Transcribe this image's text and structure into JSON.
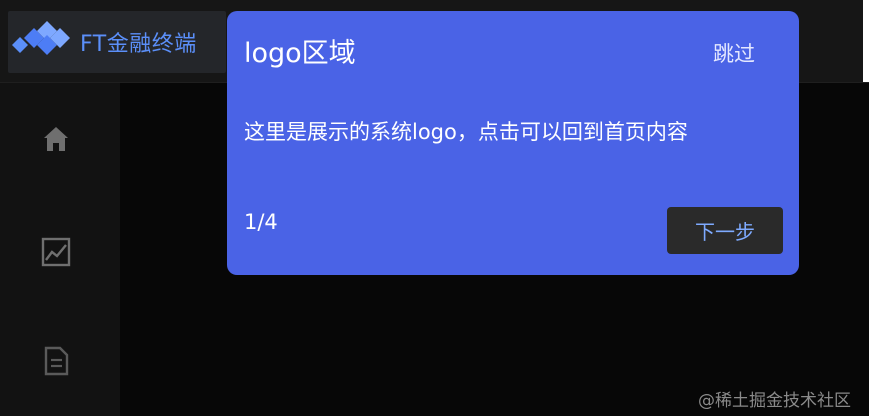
{
  "header": {
    "brand": "FT金融终端"
  },
  "sidebar": {
    "items": [
      {
        "icon": "home-icon"
      },
      {
        "icon": "trend-chart-icon"
      },
      {
        "icon": "document-icon"
      }
    ]
  },
  "tour": {
    "title": "logo区域",
    "skip_label": "跳过",
    "description": "这里是展示的系统logo，点击可以回到首页内容",
    "step": "1/4",
    "next_label": "下一步"
  },
  "watermark": "@稀土掘金技术社区",
  "colors": {
    "page_bg": "#070707",
    "header_bg": "#161616",
    "sidebar_bg": "#121212",
    "tour_bg": "#4a63e6",
    "brand_text": "#5b8ff9",
    "next_button_bg": "#2a2a2a",
    "next_button_text": "#7eaaff"
  }
}
